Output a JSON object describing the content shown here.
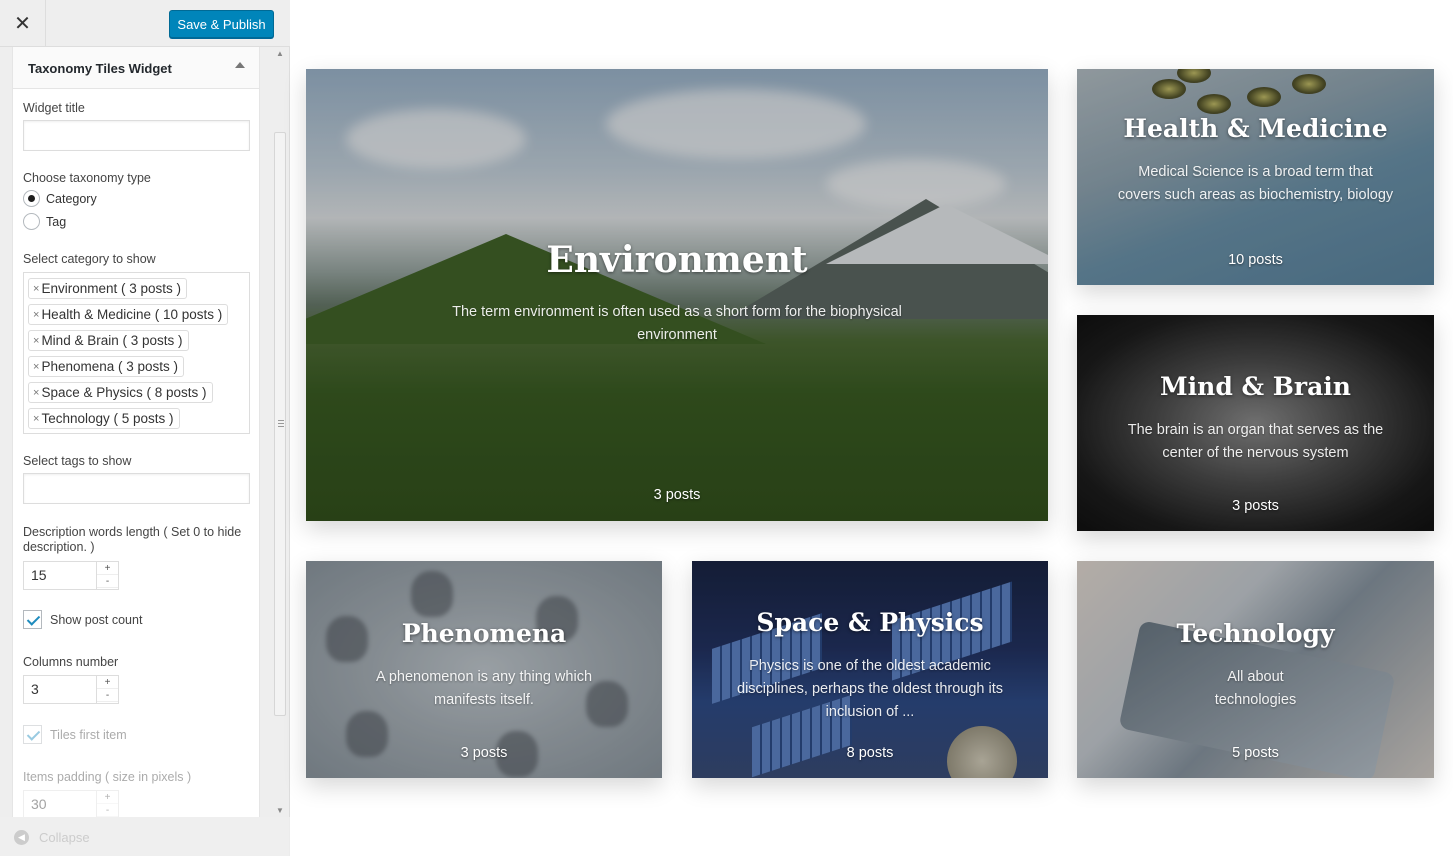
{
  "topbar": {
    "close_icon": "close-icon",
    "publish_label": "Save & Publish"
  },
  "widget": {
    "title": "Taxonomy Tiles Widget",
    "widget_title_label": "Widget title",
    "widget_title_value": "",
    "taxonomy_label": "Choose taxonomy type",
    "taxonomy_options": [
      "Category",
      "Tag"
    ],
    "taxonomy_selected": "Category",
    "category_label": "Select category to show",
    "categories": [
      "Environment ( 3 posts )",
      "Health & Medicine ( 10 posts )",
      "Mind & Brain ( 3 posts )",
      "Phenomena ( 3 posts )",
      "Space & Physics ( 8 posts )",
      "Technology ( 5 posts )"
    ],
    "remove_glyph": "×",
    "tags_label": "Select tags to show",
    "tags_value": "",
    "desc_length_label": "Description words length ( Set 0 to hide description. )",
    "desc_length_value": "15",
    "show_count_label": "Show post count",
    "show_count_checked": true,
    "columns_label": "Columns number",
    "columns_value": "3",
    "tiles_first_label": "Tiles first item",
    "tiles_first_checked": true,
    "padding_label": "Items padding ( size in pixels )",
    "padding_value": "30",
    "stepper_plus": "+",
    "stepper_minus": "-"
  },
  "footer": {
    "collapse_label": "Collapse"
  },
  "tiles": {
    "environment": {
      "title": "Environment",
      "desc": "The term environment is often used as a short form for the biophysical environment",
      "count": "3 posts"
    },
    "health": {
      "title": "Health & Medicine",
      "desc": "Medical Science is a broad term that covers such areas as biochemistry, biology",
      "count": "10 posts"
    },
    "mind": {
      "title": "Mind & Brain",
      "desc": "The brain is an organ that serves as the center of the nervous system",
      "count": "3 posts"
    },
    "phenomena": {
      "title": "Phenomena",
      "desc": "A phenomenon is any thing which manifests itself.",
      "count": "3 posts"
    },
    "space": {
      "title": "Space & Physics",
      "desc": "Physics is one of the oldest academic disciplines, perhaps the oldest through its inclusion of ...",
      "count": "8 posts"
    },
    "technology": {
      "title": "Technology",
      "desc": "All about technologies",
      "count": "5 posts"
    }
  },
  "colors": {
    "accent": "#0085ba",
    "sidebar_bg": "#eeeeee"
  }
}
